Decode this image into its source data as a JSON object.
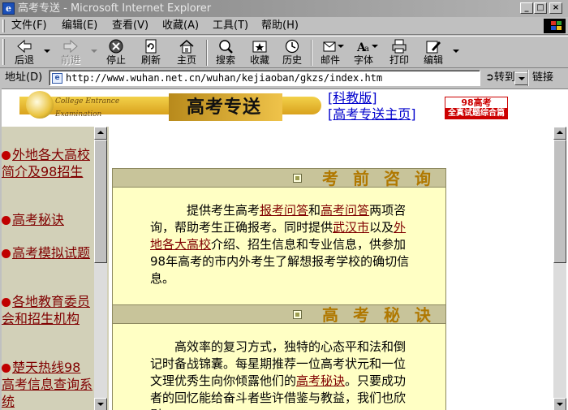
{
  "window": {
    "title": "高考专送 - Microsoft Internet Explorer",
    "minimize": "_",
    "maximize": "□",
    "close": "×"
  },
  "menu": [
    {
      "label": "文件(F)"
    },
    {
      "label": "编辑(E)"
    },
    {
      "label": "查看(V)"
    },
    {
      "label": "收藏(A)"
    },
    {
      "label": "工具(T)"
    },
    {
      "label": "帮助(H)"
    }
  ],
  "toolbar": [
    {
      "label": "后退",
      "icon": "back-arrow-icon",
      "enabled": true
    },
    {
      "label": "前进",
      "icon": "forward-arrow-icon",
      "enabled": false
    },
    {
      "label": "停止",
      "icon": "stop-icon",
      "enabled": true
    },
    {
      "label": "刷新",
      "icon": "refresh-icon",
      "enabled": true
    },
    {
      "label": "主页",
      "icon": "home-icon",
      "enabled": true
    },
    {
      "label": "搜索",
      "icon": "search-icon",
      "enabled": true
    },
    {
      "label": "收藏",
      "icon": "favorites-icon",
      "enabled": true
    },
    {
      "label": "历史",
      "icon": "history-icon",
      "enabled": true
    },
    {
      "label": "邮件",
      "icon": "mail-icon",
      "enabled": true
    },
    {
      "label": "字体",
      "icon": "font-icon",
      "enabled": true
    },
    {
      "label": "打印",
      "icon": "print-icon",
      "enabled": true
    },
    {
      "label": "编辑",
      "icon": "edit-icon",
      "enabled": true
    }
  ],
  "address": {
    "label": "地址(D)",
    "url": "http://www.wuhan.net.cn/wuhan/kejiaoban/gkzs/index.htm",
    "go_label": "转到",
    "links_label": "链接"
  },
  "banner": {
    "logo_text_line1": "College Entrance",
    "logo_text_line2": "Examination",
    "title": "高考专送",
    "link1": "科教版",
    "link2": "高考专送主页",
    "badge_line1": "98高考",
    "badge_line2": "全真试题综合篇"
  },
  "sidebar": {
    "items": [
      {
        "label": "外地各大高校简介及98招生"
      },
      {
        "label": "高考秘诀"
      },
      {
        "label": "高考模拟试题"
      },
      {
        "label": "各地教育委员会和招生机构"
      },
      {
        "label": "楚天热线98高考信息查询系统"
      }
    ]
  },
  "sections": [
    {
      "heading": "考前咨询",
      "p_a": "提供考生高考",
      "link_a": "报考问答",
      "p_b": "和",
      "link_b": "高考问答",
      "p_c": "两项咨询，帮助考生正确报考。同时提供",
      "link_c": "武汉市",
      "p_d": "以及",
      "link_d": "外地各大高校",
      "p_e": "介绍、招生信息和专业信息，供参加98年高考的市内外考生了解想报考学校的确切信息。"
    },
    {
      "heading": "高考秘诀",
      "p_a": "高效率的复习方式，独特的心态平和法和倒记时备战锦囊。每星期推荐一位高考状元和一位文理优秀生向你倾露他们的",
      "link_a": "高考秘诀",
      "p_b": "。只要成功者的回忆能给奋斗者些许借鉴与教益，我们也欣慰。"
    }
  ],
  "colors": {
    "titlebar_inactive": "#808080",
    "sidebar_bg": "#d2d0b8",
    "section_header_bg": "#c8c49a",
    "section_body_bg": "#ffffc4",
    "link_color": "#800000",
    "heading_color": "#b07800"
  }
}
